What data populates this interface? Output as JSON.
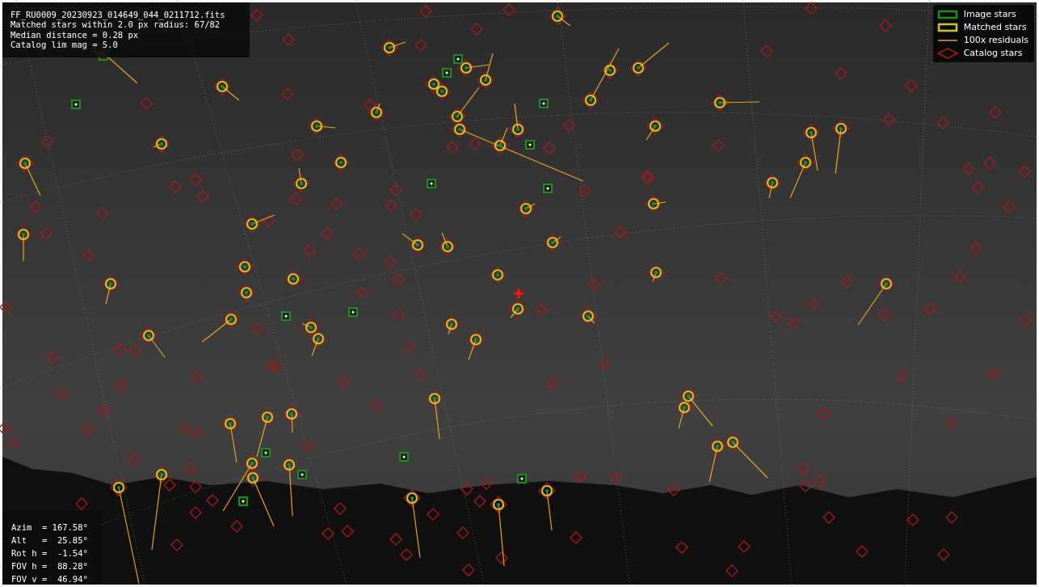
{
  "info_box": {
    "lines": [
      "FF_RU0009_20230923_014649_044_0211712.fits",
      "Matched stars within 2.0 px radius: 67/82",
      "Median distance = 0.28 px",
      "Catalog lim mag = 5.0"
    ]
  },
  "legend": {
    "items": [
      {
        "kind": "image",
        "label": "Image stars"
      },
      {
        "kind": "matched",
        "label": "Matched stars"
      },
      {
        "kind": "residual",
        "label": "100x residuals"
      },
      {
        "kind": "catalog",
        "label": "Catalog stars"
      }
    ]
  },
  "pointing_box": {
    "lines": [
      "Azim  = 167.58°",
      "Alt   =  25.85°",
      "Rot h =  -1.54°",
      "FOV h =  88.28°",
      "FOV v =  46.94°"
    ]
  }
}
